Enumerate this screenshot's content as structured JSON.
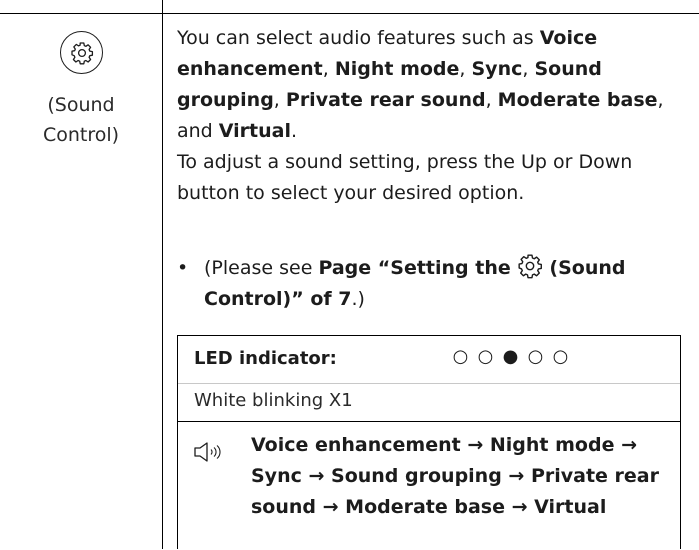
{
  "left_cell": {
    "icon": "gear-icon",
    "label_line1": "(Sound",
    "label_line2": "Control)"
  },
  "description": {
    "p1_a": "You can select audio features such as ",
    "f1": "Voice enhancement",
    "sep1": ", ",
    "f2": "Night mode",
    "sep2": ", ",
    "f3": "Sync",
    "sep3": ", ",
    "f4": "Sound grouping",
    "sep4": ", ",
    "f5": "Private rear sound",
    "sep5": ", ",
    "f6": "Moderate base",
    "sep6": ", and ",
    "f7": "Virtual",
    "end": ".",
    "p2": "To adjust a sound setting, press the Up or Down button to select your desired option."
  },
  "bullet": {
    "dot": "•",
    "pre": "(Please see ",
    "ref_a": "Page “Setting the ",
    "ref_b": "(Sound Control)” of 7",
    "post": ".)"
  },
  "led": {
    "label": "LED indicator:",
    "dots": [
      "○",
      "○",
      "●",
      "○",
      "○"
    ],
    "status": "White blinking X1",
    "sequence": "Voice enhancement → Night mode → Sync → Sound grouping → Private rear sound → Moderate base → Virtual"
  }
}
